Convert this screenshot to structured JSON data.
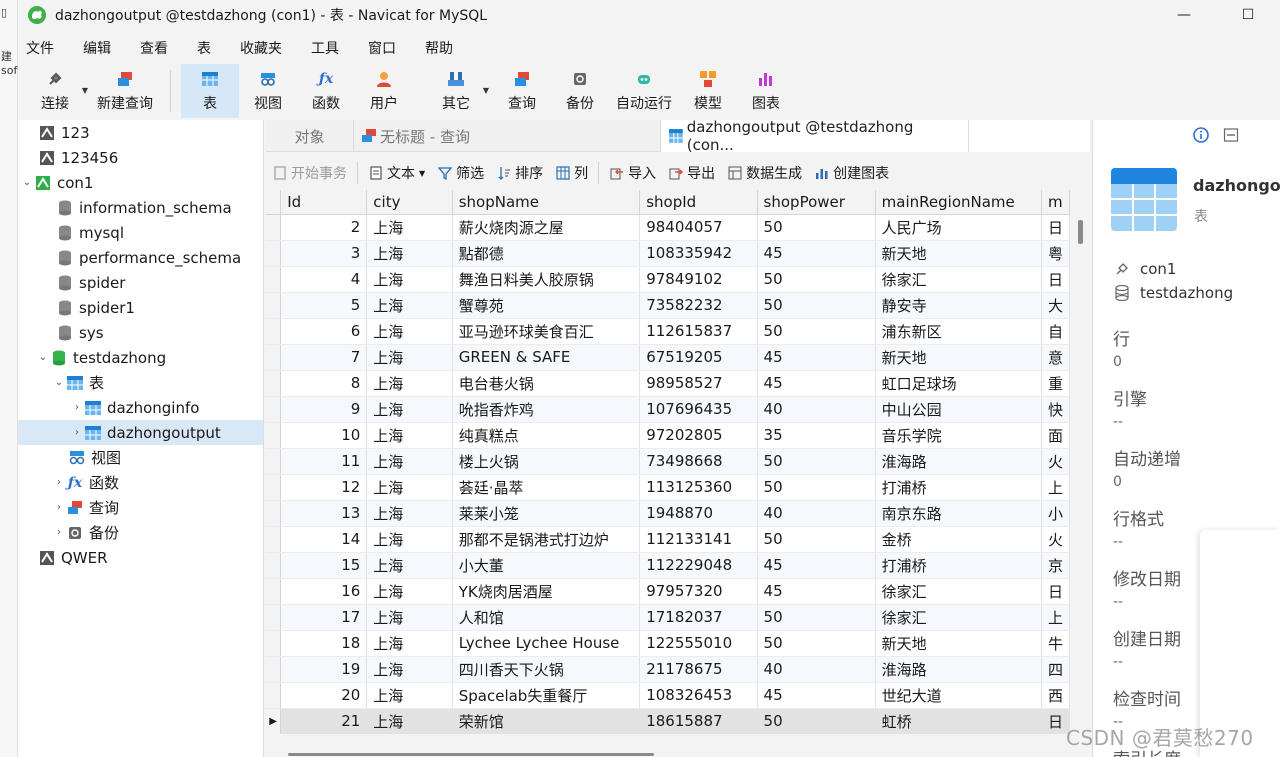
{
  "window": {
    "title": "dazhongoutput @testdazhong (con1) - 表 - Navicat for MySQL",
    "minimize": "—",
    "maximize": "☐"
  },
  "edge_fragments": [
    "建",
    "sof"
  ],
  "menu": [
    "文件",
    "编辑",
    "查看",
    "表",
    "收藏夹",
    "工具",
    "窗口",
    "帮助"
  ],
  "toolbar": {
    "connect": "连接",
    "new_query": "新建查询",
    "table": "表",
    "view": "视图",
    "function": "函数",
    "user": "用户",
    "other": "其它",
    "query": "查询",
    "backup": "备份",
    "automation": "自动运行",
    "model": "模型",
    "chart": "图表"
  },
  "tree": {
    "conn_123": "123",
    "conn_123456": "123456",
    "con1": "con1",
    "db_information_schema": "information_schema",
    "db_mysql": "mysql",
    "db_performance_schema": "performance_schema",
    "db_spider": "spider",
    "db_spider1": "spider1",
    "db_sys": "sys",
    "db_testdazhong": "testdazhong",
    "tables_group": "表",
    "table_dazhonginfo": "dazhonginfo",
    "table_dazhongoutput": "dazhongoutput",
    "views_group": "视图",
    "functions_group": "函数",
    "queries_group": "查询",
    "backups_group": "备份",
    "conn_qwer": "QWER"
  },
  "tabs": {
    "objects": "对象",
    "untitled_query": "无标题 - 查询",
    "table_tab": "dazhongoutput @testdazhong (con..."
  },
  "data_toolbar": {
    "begin_transaction": "开始事务",
    "text": "文本",
    "filter": "筛选",
    "sort": "排序",
    "columns": "列",
    "import": "导入",
    "export": "导出",
    "data_generation": "数据生成",
    "create_chart": "创建图表"
  },
  "table": {
    "columns": [
      "Id",
      "city",
      "shopName",
      "shopId",
      "shopPower",
      "mainRegionName",
      "m"
    ],
    "rows": [
      [
        "2",
        "上海",
        "薪火烧肉源之屋",
        "98404057",
        "50",
        "人民广场",
        "日"
      ],
      [
        "3",
        "上海",
        "點都德",
        "108335942",
        "45",
        "新天地",
        "粤"
      ],
      [
        "4",
        "上海",
        "舞渔日料美人胶原锅",
        "97849102",
        "50",
        "徐家汇",
        "日"
      ],
      [
        "5",
        "上海",
        "蟹尊苑",
        "73582232",
        "50",
        "静安寺",
        "大"
      ],
      [
        "6",
        "上海",
        "亚马逊环球美食百汇",
        "112615837",
        "50",
        "浦东新区",
        "自"
      ],
      [
        "7",
        "上海",
        "GREEN & SAFE",
        "67519205",
        "45",
        "新天地",
        "意"
      ],
      [
        "8",
        "上海",
        "电台巷火锅",
        "98958527",
        "45",
        "虹口足球场",
        "重"
      ],
      [
        "9",
        "上海",
        "吮指香炸鸡",
        "107696435",
        "40",
        "中山公园",
        "快"
      ],
      [
        "10",
        "上海",
        "纯真糕点",
        "97202805",
        "35",
        "音乐学院",
        "面"
      ],
      [
        "11",
        "上海",
        "楼上火锅",
        "73498668",
        "50",
        "淮海路",
        "火"
      ],
      [
        "12",
        "上海",
        "荟廷·晶萃",
        "113125360",
        "50",
        "打浦桥",
        "上"
      ],
      [
        "13",
        "上海",
        "莱莱小笼",
        "1948870",
        "40",
        "南京东路",
        "小"
      ],
      [
        "14",
        "上海",
        "那都不是锅港式打边炉",
        "112133141",
        "50",
        "金桥",
        "火"
      ],
      [
        "15",
        "上海",
        "小大董",
        "112229048",
        "45",
        "打浦桥",
        "京"
      ],
      [
        "16",
        "上海",
        "YK烧肉居酒屋",
        "97957320",
        "45",
        "徐家汇",
        "日"
      ],
      [
        "17",
        "上海",
        "人和馆",
        "17182037",
        "50",
        "徐家汇",
        "上"
      ],
      [
        "18",
        "上海",
        "Lychee Lychee House",
        "122555010",
        "50",
        "新天地",
        "牛"
      ],
      [
        "19",
        "上海",
        "四川香天下火锅",
        "21178675",
        "40",
        "淮海路",
        "四"
      ],
      [
        "20",
        "上海",
        "Spacelab失重餐厅",
        "108326453",
        "45",
        "世纪大道",
        "西"
      ],
      [
        "21",
        "上海",
        "荣新馆",
        "18615887",
        "50",
        "虹桥",
        "日"
      ]
    ]
  },
  "right_panel": {
    "object_name": "dazhongou",
    "object_type": "表",
    "connection": "con1",
    "database": "testdazhong",
    "props": [
      {
        "key": "行",
        "value": "0"
      },
      {
        "key": "引擎",
        "value": "--"
      },
      {
        "key": "自动递增",
        "value": "0"
      },
      {
        "key": "行格式",
        "value": "--"
      },
      {
        "key": "修改日期",
        "value": "--"
      },
      {
        "key": "创建日期",
        "value": "--"
      },
      {
        "key": "检查时间",
        "value": "--"
      },
      {
        "key": "索引长度",
        "value": ""
      }
    ]
  },
  "watermark": "CSDN @君莫愁270"
}
